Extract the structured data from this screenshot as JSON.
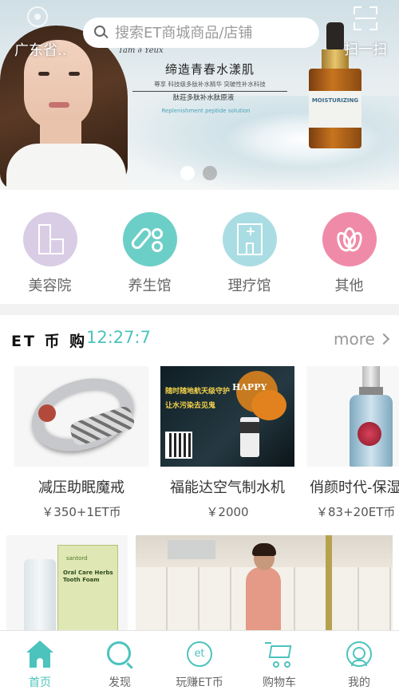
{
  "header": {
    "location": "广东省..",
    "search_placeholder": "搜索ET商城商品/店铺",
    "scan_label": "扫一扫"
  },
  "banner": {
    "cursive_text": "Tam ∂ Yeux",
    "title": "缔造青春水漾肌",
    "line1": "尊享 科技级多肽补水精华 突破性补水科技",
    "line2": "肽莊多肽补水肽原液",
    "line3": "Replenishment peptide solution",
    "bottle_label": "MOISTURIZING",
    "slides": 2,
    "active_slide": 0
  },
  "categories": [
    {
      "label": "美容院",
      "icon": "building-icon",
      "color": "#d9cde6"
    },
    {
      "label": "养生馆",
      "icon": "pills-icon",
      "color": "#6ccfc7"
    },
    {
      "label": "理疗馆",
      "icon": "clinic-icon",
      "color": "#a9dde3"
    },
    {
      "label": "其他",
      "icon": "lotus-icon",
      "color": "#f08aa9"
    }
  ],
  "et_section": {
    "title": "ET 币 购",
    "timer": "12:27:7",
    "more_label": "more",
    "products": [
      {
        "name": "减压助眠魔戒",
        "price": "￥350+1ET币",
        "image": "ring"
      },
      {
        "name": "福能达空气制水机",
        "price": "￥2000",
        "image": "halloween-water-machine"
      },
      {
        "name": "俏颜时代-保湿",
        "price": "￥83+20ET币",
        "image": "spray-bottle"
      }
    ],
    "lower_images": {
      "toothpaste_brand": "santord",
      "toothpaste_title": "Oral Care Herbs Tooth Foam"
    },
    "halloween": {
      "happy": "HAPPY",
      "text1": "随时随地航天级守护",
      "text2": "让水污染去见鬼"
    }
  },
  "bottom_nav": [
    {
      "label": "首页",
      "icon": "home-icon",
      "active": true
    },
    {
      "label": "发现",
      "icon": "discover-icon",
      "active": false
    },
    {
      "label": "玩赚ET币",
      "icon": "et-coin-icon",
      "active": false
    },
    {
      "label": "购物车",
      "icon": "cart-icon",
      "active": false
    },
    {
      "label": "我的",
      "icon": "profile-icon",
      "active": false
    }
  ],
  "colors": {
    "accent": "#4cc3bd",
    "text_dark": "#333333",
    "text_muted": "#999999"
  }
}
